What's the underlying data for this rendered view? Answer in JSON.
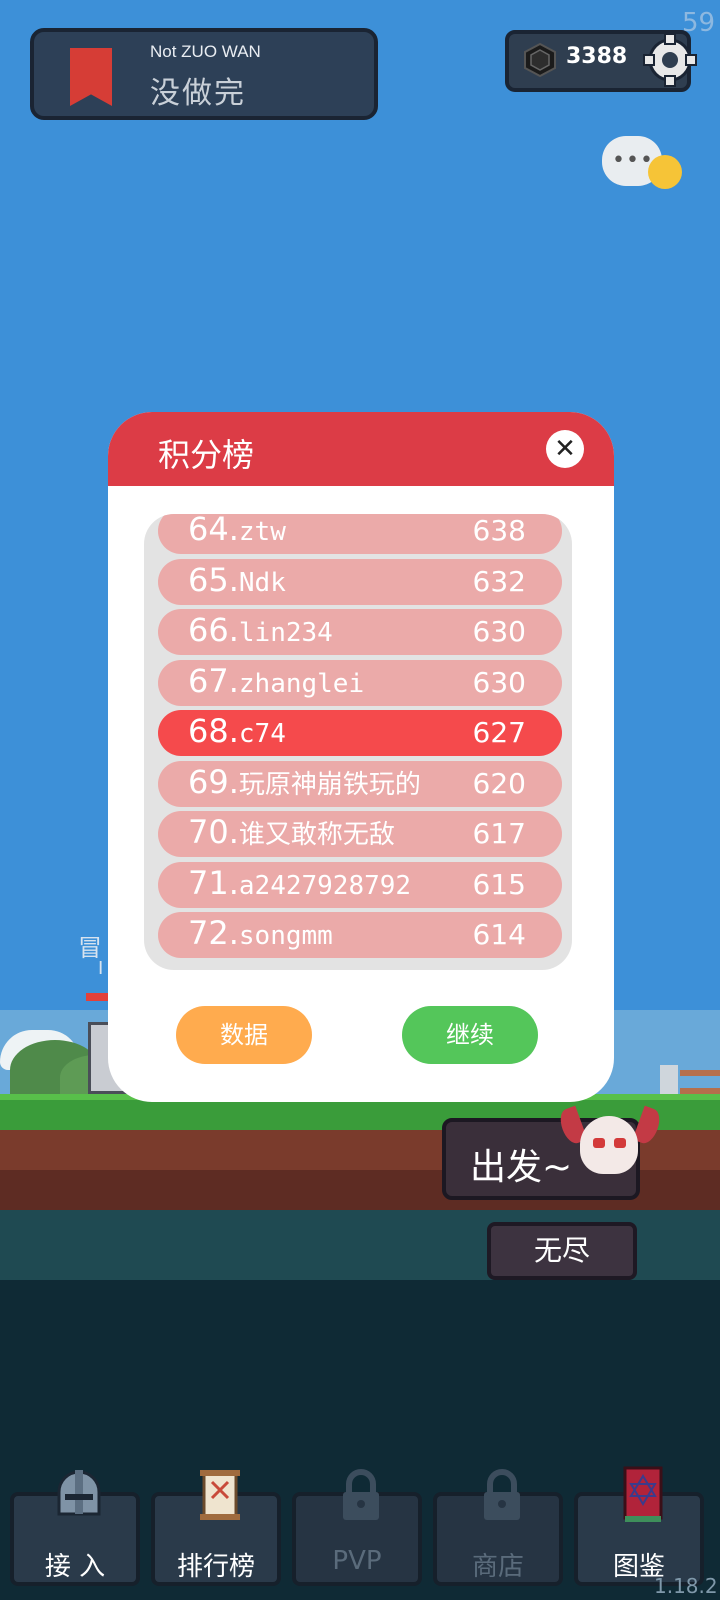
{
  "status": {
    "fps": "59",
    "version": "1.18.2"
  },
  "task": {
    "title_en": "Not ZUO WAN",
    "title_cn": "没做完"
  },
  "currency": {
    "value": "3388",
    "icon": "gem-icon"
  },
  "leaderboard": {
    "title": "积分榜",
    "rows": [
      {
        "rank": "64.",
        "name": "ztw",
        "score": "638",
        "highlight": false
      },
      {
        "rank": "65.",
        "name": "Ndk",
        "score": "632",
        "highlight": false
      },
      {
        "rank": "66.",
        "name": "lin234",
        "score": "630",
        "highlight": false
      },
      {
        "rank": "67.",
        "name": "zhanglei",
        "score": "630",
        "highlight": false
      },
      {
        "rank": "68.",
        "name": "c74",
        "score": "627",
        "highlight": true
      },
      {
        "rank": "69.",
        "name": "玩原神崩铁玩的",
        "score": "620",
        "highlight": false
      },
      {
        "rank": "70.",
        "name": "谁又敢称无敌",
        "score": "617",
        "highlight": false
      },
      {
        "rank": "71.",
        "name": "a2427928792",
        "score": "615",
        "highlight": false
      },
      {
        "rank": "72.",
        "name": "songmm",
        "score": "614",
        "highlight": false
      }
    ],
    "data_button": "数据",
    "continue_button": "继续"
  },
  "game": {
    "peek_label_1": "冒",
    "peek_label_2": "I",
    "start_label": "出发~",
    "endless_label": "无尽"
  },
  "nav": [
    {
      "label": "接 入",
      "locked": false
    },
    {
      "label": "排行榜",
      "locked": false
    },
    {
      "label": "PVP",
      "locked": true
    },
    {
      "label": "商店",
      "locked": true
    },
    {
      "label": "图鉴",
      "locked": false
    }
  ],
  "colors": {
    "header_red": "#dc3c46",
    "row_pink": "#ebaaa9",
    "row_highlight": "#f54a4c",
    "orange": "#ffab4e",
    "green": "#54c65a"
  }
}
